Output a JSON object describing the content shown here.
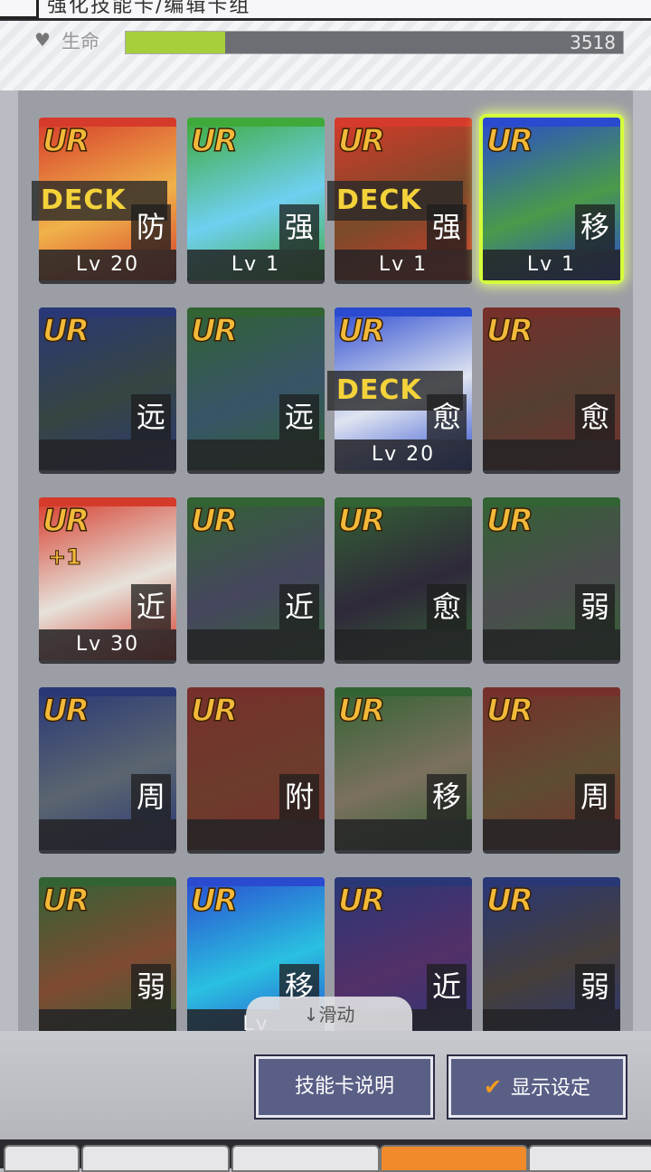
{
  "header": {
    "title": "强化技能卡/编辑卡组"
  },
  "hp": {
    "label": "生命",
    "value": "3518",
    "fill_fraction": 0.2
  },
  "cards": [
    {
      "rarity": "UR",
      "type": "防",
      "level": "Lv 20",
      "deck": "DECK",
      "colors": [
        "#d63a2a",
        "#f0b24a"
      ],
      "dim": false
    },
    {
      "rarity": "UR",
      "type": "强",
      "level": "Lv 1",
      "deck": "",
      "colors": [
        "#3faa3a",
        "#6fd0f0"
      ],
      "dim": false
    },
    {
      "rarity": "UR",
      "type": "强",
      "level": "Lv 1",
      "deck": "DECK",
      "colors": [
        "#d63a2a",
        "#7a4a2a"
      ],
      "dim": false
    },
    {
      "rarity": "UR",
      "type": "移",
      "level": "Lv 1",
      "deck": "",
      "colors": [
        "#2a4ad0",
        "#4a9a4a"
      ],
      "dim": false,
      "selected": true
    },
    {
      "rarity": "UR",
      "type": "远",
      "level": "",
      "deck": "",
      "colors": [
        "#2a4ad0",
        "#4a6a5a"
      ],
      "dim": true
    },
    {
      "rarity": "UR",
      "type": "远",
      "level": "",
      "deck": "",
      "colors": [
        "#3faa3a",
        "#4a8ab0"
      ],
      "dim": true
    },
    {
      "rarity": "UR",
      "type": "愈",
      "level": "Lv 20",
      "deck": "DECK",
      "colors": [
        "#2a4ad0",
        "#dfe4f0"
      ],
      "dim": false
    },
    {
      "rarity": "UR",
      "type": "愈",
      "level": "",
      "deck": "",
      "colors": [
        "#d63a2a",
        "#8a5a3a"
      ],
      "dim": true
    },
    {
      "rarity": "UR",
      "type": "近",
      "level": "Lv 30",
      "deck": "",
      "plus": "+1",
      "colors": [
        "#d63a2a",
        "#e6e2da"
      ],
      "dim": false
    },
    {
      "rarity": "UR",
      "type": "近",
      "level": "",
      "deck": "",
      "colors": [
        "#3faa3a",
        "#6a6a9a"
      ],
      "dim": true
    },
    {
      "rarity": "UR",
      "type": "愈",
      "level": "",
      "deck": "",
      "colors": [
        "#3faa3a",
        "#3a2a4a"
      ],
      "dim": true
    },
    {
      "rarity": "UR",
      "type": "弱",
      "level": "",
      "deck": "",
      "colors": [
        "#3faa3a",
        "#777777"
      ],
      "dim": true
    },
    {
      "rarity": "UR",
      "type": "周",
      "level": "",
      "deck": "",
      "colors": [
        "#2a4ad0",
        "#9ab0c0"
      ],
      "dim": true
    },
    {
      "rarity": "UR",
      "type": "附",
      "level": "",
      "deck": "",
      "colors": [
        "#d63a2a",
        "#c0542a"
      ],
      "dim": true
    },
    {
      "rarity": "UR",
      "type": "移",
      "level": "",
      "deck": "",
      "colors": [
        "#3faa3a",
        "#e0c89a"
      ],
      "dim": true
    },
    {
      "rarity": "UR",
      "type": "周",
      "level": "",
      "deck": "",
      "colors": [
        "#d63a2a",
        "#a07a3a"
      ],
      "dim": true
    },
    {
      "rarity": "UR",
      "type": "弱",
      "level": "",
      "deck": "",
      "colors": [
        "#3faa3a",
        "#e8743a"
      ],
      "dim": true
    },
    {
      "rarity": "UR",
      "type": "移",
      "level": "Lv",
      "deck": "",
      "colors": [
        "#2a4ad0",
        "#2ac0e0"
      ],
      "dim": false
    },
    {
      "rarity": "UR",
      "type": "近",
      "level": "",
      "deck": "",
      "colors": [
        "#2a4ad0",
        "#8a3ab0"
      ],
      "dim": true
    },
    {
      "rarity": "UR",
      "type": "弱",
      "level": "",
      "deck": "",
      "colors": [
        "#2a4ad0",
        "#6a5a4a"
      ],
      "dim": true
    }
  ],
  "scroll_hint": "↓滑动",
  "buttons": {
    "skill_info": "技能卡说明",
    "display_settings": "显示设定"
  }
}
